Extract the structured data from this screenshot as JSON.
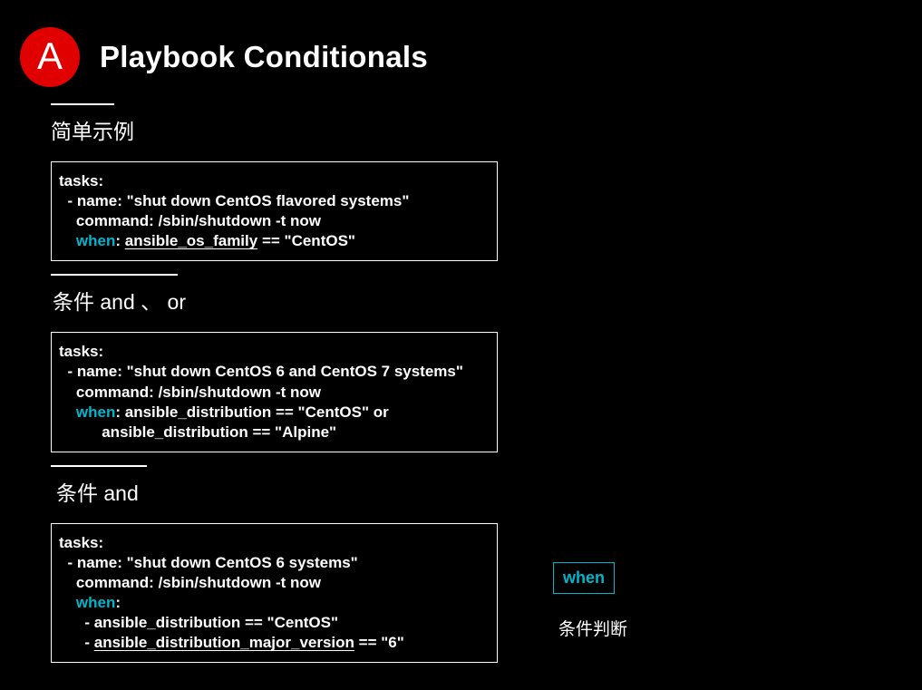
{
  "header": {
    "logo_letter": "A",
    "title": "Playbook Conditionals"
  },
  "sections": [
    {
      "title": "简单示例"
    },
    {
      "title": "条件 and 、 or"
    },
    {
      "title": "条件 and"
    }
  ],
  "code1": {
    "l1": "tasks:",
    "l2": "  - name: \"shut down CentOS flavored systems\"",
    "l3": "    command: /sbin/shutdown -t now",
    "l4_pre": "    ",
    "l4_kw": "when",
    "l4_mid": ": ",
    "l4_ul": "ansible_os_family",
    "l4_post": " == \"CentOS\""
  },
  "code2": {
    "l1": "tasks:",
    "l2": "  - name: \"shut down CentOS 6 and CentOS 7 systems\"",
    "l3": "    command: /sbin/shutdown -t now",
    "l4_pre": "    ",
    "l4_kw": "when",
    "l4_post": ": ansible_distribution == \"CentOS\" or",
    "l5": "          ansible_distribution == \"Alpine\""
  },
  "code3": {
    "l1": "tasks:",
    "l2": "  - name: \"shut down CentOS 6 systems\"",
    "l3": "    command: /sbin/shutdown -t now",
    "l4_pre": "    ",
    "l4_kw": "when",
    "l4_post": ":",
    "l5": "      - ansible_distribution == \"CentOS\"",
    "l6_pre": "      - ",
    "l6_ul": "ansible_distribution_major_version",
    "l6_post": " == \"6\""
  },
  "side": {
    "badge": "when",
    "label": "条件判断"
  }
}
